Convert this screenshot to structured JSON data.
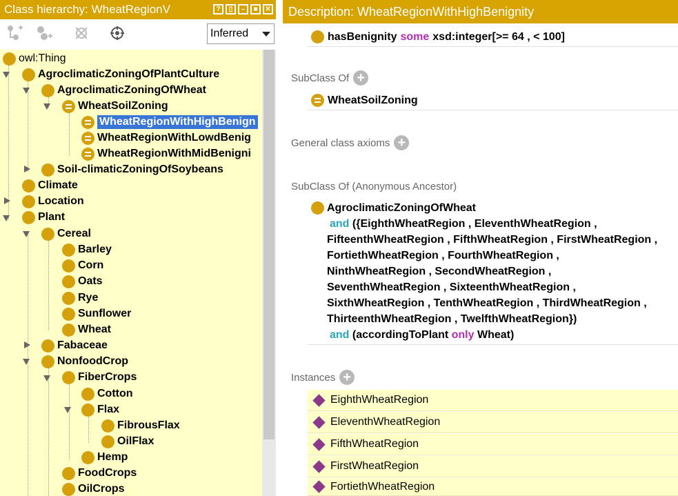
{
  "left_panel": {
    "title": "Class hierarchy: WheatRegionV",
    "title_buttons": [
      "?",
      "▯",
      "–",
      "■",
      "✕"
    ],
    "toolbar": {
      "icons": [
        "add-subclass-icon",
        "add-sibling-icon",
        "delete-class-icon",
        "target-icon"
      ],
      "reasoner_select": "Inferred"
    },
    "tree": [
      {
        "label": "owl:Thing",
        "bold": false
      },
      {
        "label": "AgroclimaticZoningOfPlantCulture"
      },
      {
        "label": "AgroclimaticZoningOfWheat"
      },
      {
        "label": "WheatSoilZoning"
      },
      {
        "label": "WheatRegionWithHighBenign"
      },
      {
        "label": "WheatRegionWithLowdBenig"
      },
      {
        "label": "WheatRegionWithMidBenigni"
      },
      {
        "label": "Soil-climaticZoningOfSoybeans"
      },
      {
        "label": "Climate"
      },
      {
        "label": "Location"
      },
      {
        "label": "Plant"
      },
      {
        "label": "Cereal"
      },
      {
        "label": "Barley"
      },
      {
        "label": "Corn"
      },
      {
        "label": "Oats"
      },
      {
        "label": "Rye"
      },
      {
        "label": "Sunflower"
      },
      {
        "label": "Wheat"
      },
      {
        "label": "Fabaceae"
      },
      {
        "label": "NonfoodCrop"
      },
      {
        "label": "FiberCrops"
      },
      {
        "label": "Cotton"
      },
      {
        "label": "Flax"
      },
      {
        "label": "FibrousFlax"
      },
      {
        "label": "OilFlax"
      },
      {
        "label": "Hemp"
      },
      {
        "label": "FoodCrops"
      },
      {
        "label": "OilCrops"
      }
    ]
  },
  "right_panel": {
    "title": "Description: WheatRegionWithHighBenignity",
    "equivalent": {
      "property": "hasBenignity",
      "keyword": "some",
      "range": "xsd:integer[>= 64 , < 100]"
    },
    "subclass_of": {
      "label": "SubClass Of",
      "items": [
        "WheatSoilZoning"
      ]
    },
    "general_axioms": {
      "label": "General class axioms"
    },
    "anonymous_ancestor": {
      "label": "SubClass Of (Anonymous Ancestor)",
      "class": "AgroclimaticZoningOfWheat",
      "and1": "and",
      "line1": "({EighthWheatRegion , EleventhWheatRegion ,",
      "line2": "FifteenthWheatRegion , FifthWheatRegion , FirstWheatRegion ,",
      "line3": "FortiethWheatRegion , FourthWheatRegion ,",
      "line4": "NinthWheatRegion , SecondWheatRegion ,",
      "line5": "SeventhWheatRegion , SixteenthWheatRegion ,",
      "line6": "SixthWheatRegion , TenthWheatRegion , ThirdWheatRegion ,",
      "line7": "ThirteenthWheatRegion , TwelfthWheatRegion})",
      "and2": "and",
      "restriction_prop": "(accordingToPlant",
      "restriction_kw": "only",
      "restriction_filler": "Wheat)"
    },
    "instances": {
      "label": "Instances",
      "items": [
        "EighthWheatRegion",
        "EleventhWheatRegion",
        "FifthWheatRegion",
        "FirstWheatRegion",
        "FortiethWheatRegion"
      ]
    }
  }
}
